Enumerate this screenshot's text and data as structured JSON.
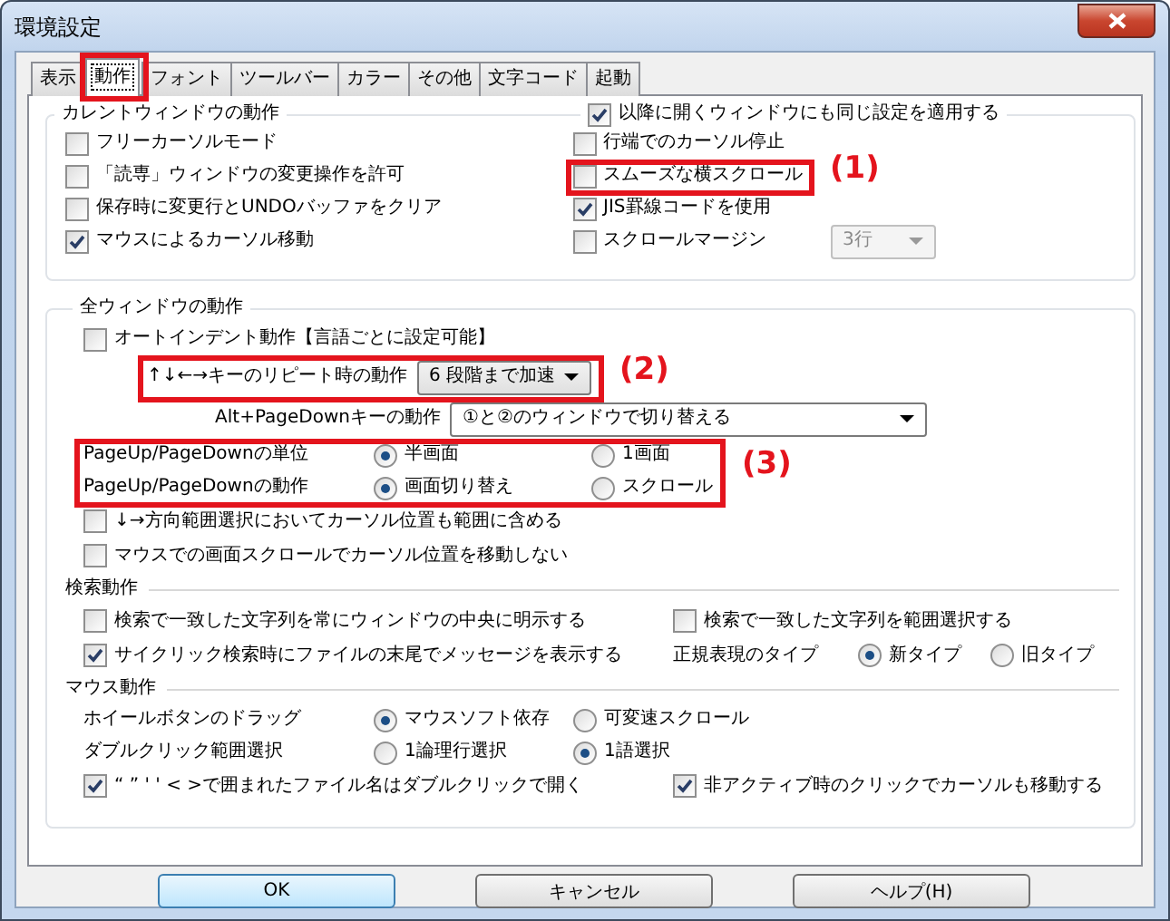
{
  "window": {
    "title": "環境設定"
  },
  "tabs": [
    {
      "label": "表示",
      "selected": false
    },
    {
      "label": "動作",
      "selected": true
    },
    {
      "label": "フォント",
      "selected": false
    },
    {
      "label": "ツールバー",
      "selected": false
    },
    {
      "label": "カラー",
      "selected": false
    },
    {
      "label": "その他",
      "selected": false
    },
    {
      "label": "文字コード",
      "selected": false
    },
    {
      "label": "起動",
      "selected": false
    }
  ],
  "current_window": {
    "title": "カレントウィンドウの動作",
    "apply_all": {
      "label": "以降に開くウィンドウにも同じ設定を適用する",
      "checked": true
    },
    "left": [
      {
        "label": "フリーカーソルモード",
        "checked": false
      },
      {
        "label": "「読専」ウィンドウの変更操作を許可",
        "checked": false
      },
      {
        "label": "保存時に変更行とUNDOバッファをクリア",
        "checked": false
      },
      {
        "label": "マウスによるカーソル移動",
        "checked": true
      }
    ],
    "right": [
      {
        "label": "行端でのカーソル停止",
        "checked": false
      },
      {
        "label": "スムーズな横スクロール",
        "checked": false
      },
      {
        "label": "JIS罫線コードを使用",
        "checked": true
      },
      {
        "label": "スクロールマージン",
        "checked": false,
        "value": "3行",
        "disabled": true
      }
    ]
  },
  "all_windows": {
    "title": "全ウィンドウの動作",
    "auto_indent": {
      "label": "オートインデント動作【言語ごとに設定可能】",
      "checked": false
    },
    "repeat": {
      "label": "↑↓←→キーのリピート時の動作",
      "value": "6 段階まで加速"
    },
    "alt_pagedown": {
      "label": "Alt+PageDownキーの動作",
      "value": "①と②のウィンドウで切り替える"
    },
    "radio_rows": [
      {
        "label": "PageUp/PageDownの単位",
        "options": [
          {
            "label": "半画面",
            "selected": true
          },
          {
            "label": "1画面",
            "selected": false
          }
        ]
      },
      {
        "label": "PageUp/PageDownの動作",
        "options": [
          {
            "label": "画面切り替え",
            "selected": true
          },
          {
            "label": "スクロール",
            "selected": false
          }
        ]
      }
    ],
    "options": [
      {
        "label": "↓→方向範囲選択においてカーソル位置も範囲に含める",
        "checked": false
      },
      {
        "label": "マウスでの画面スクロールでカーソル位置を移動しない",
        "checked": false
      }
    ]
  },
  "search": {
    "title": "検索動作",
    "options": [
      {
        "label": "検索で一致した文字列を常にウィンドウの中央に明示する",
        "checked": false
      },
      {
        "label": "検索で一致した文字列を範囲選択する",
        "checked": false
      },
      {
        "label": "サイクリック検索時にファイルの末尾でメッセージを表示する",
        "checked": true
      }
    ],
    "regex": {
      "label": "正規表現のタイプ",
      "options": [
        {
          "label": "新タイプ",
          "selected": true
        },
        {
          "label": "旧タイプ",
          "selected": false
        }
      ]
    }
  },
  "mouse": {
    "title": "マウス動作",
    "radio_rows": [
      {
        "label": "ホイールボタンのドラッグ",
        "options": [
          {
            "label": "マウスソフト依存",
            "selected": true
          },
          {
            "label": "可変速スクロール",
            "selected": false
          }
        ]
      },
      {
        "label": "ダブルクリック範囲選択",
        "options": [
          {
            "label": "1論理行選択",
            "selected": false
          },
          {
            "label": "1語選択",
            "selected": true
          }
        ]
      }
    ],
    "options": [
      {
        "label": "“ ” ' ' < >で囲まれたファイル名はダブルクリックで開く",
        "checked": true
      },
      {
        "label": "非アクティブ時のクリックでカーソルも移動する",
        "checked": true
      }
    ]
  },
  "buttons": [
    {
      "label": "OK",
      "default": true
    },
    {
      "label": "キャンセル",
      "default": false
    },
    {
      "label": "ヘルプ(H)",
      "default": false
    }
  ],
  "annotations": [
    {
      "kind": "frame"
    },
    {
      "kind": "frame",
      "label": "(1)"
    },
    {
      "kind": "frame",
      "label": "(2)"
    },
    {
      "kind": "frame",
      "label": "(3)"
    }
  ]
}
